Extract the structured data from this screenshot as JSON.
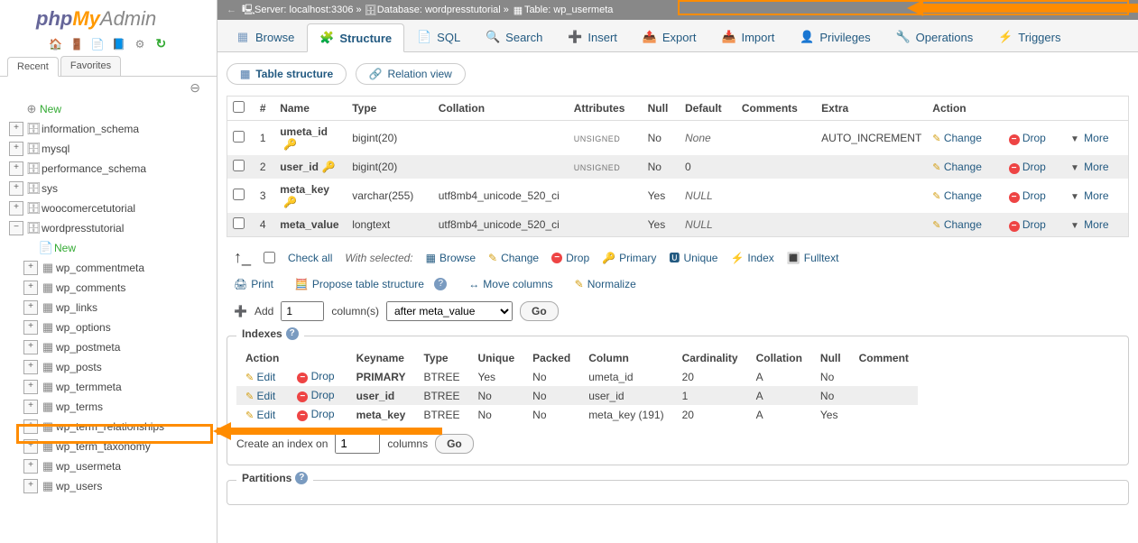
{
  "logo": {
    "php": "php",
    "my": "My",
    "admin": "Admin"
  },
  "sidebar_tabs": {
    "recent": "Recent",
    "favorites": "Favorites"
  },
  "tree": {
    "new": "New",
    "dbs": [
      "information_schema",
      "mysql",
      "performance_schema",
      "sys",
      "woocomercetutorial",
      "wordpresstutorial"
    ],
    "wp_new": "New",
    "tables": [
      "wp_commentmeta",
      "wp_comments",
      "wp_links",
      "wp_options",
      "wp_postmeta",
      "wp_posts",
      "wp_termmeta",
      "wp_terms",
      "wp_term_relationships",
      "wp_term_taxonomy",
      "wp_usermeta",
      "wp_users"
    ]
  },
  "breadcrumb": {
    "server_lbl": "Server:",
    "server_val": "localhost:3306",
    "db_lbl": "Database:",
    "db_val": "wordpresstutorial",
    "table_lbl": "Table:",
    "table_val": "wp_usermeta"
  },
  "top_tabs": {
    "browse": "Browse",
    "structure": "Structure",
    "sql": "SQL",
    "search": "Search",
    "insert": "Insert",
    "export": "Export",
    "import": "Import",
    "privileges": "Privileges",
    "operations": "Operations",
    "triggers": "Triggers"
  },
  "sub_tabs": {
    "table_structure": "Table structure",
    "relation_view": "Relation view"
  },
  "struct_headers": {
    "num": "#",
    "name": "Name",
    "type": "Type",
    "collation": "Collation",
    "attributes": "Attributes",
    "null": "Null",
    "default": "Default",
    "comments": "Comments",
    "extra": "Extra",
    "action": "Action"
  },
  "columns": [
    {
      "num": "1",
      "name": "umeta_id",
      "key": "primary",
      "type": "bigint(20)",
      "collation": "",
      "attributes": "UNSIGNED",
      "null": "No",
      "default": "None",
      "comments": "",
      "extra": "AUTO_INCREMENT"
    },
    {
      "num": "2",
      "name": "user_id",
      "key": "index",
      "type": "bigint(20)",
      "collation": "",
      "attributes": "UNSIGNED",
      "null": "No",
      "default": "0",
      "comments": "",
      "extra": ""
    },
    {
      "num": "3",
      "name": "meta_key",
      "key": "index",
      "type": "varchar(255)",
      "collation": "utf8mb4_unicode_520_ci",
      "attributes": "",
      "null": "Yes",
      "default": "NULL",
      "comments": "",
      "extra": ""
    },
    {
      "num": "4",
      "name": "meta_value",
      "key": "",
      "type": "longtext",
      "collation": "utf8mb4_unicode_520_ci",
      "attributes": "",
      "null": "Yes",
      "default": "NULL",
      "comments": "",
      "extra": ""
    }
  ],
  "row_actions": {
    "change": "Change",
    "drop": "Drop",
    "more": "More"
  },
  "checkall": {
    "check_all": "Check all",
    "with_selected": "With selected:",
    "browse": "Browse",
    "change": "Change",
    "drop": "Drop",
    "primary": "Primary",
    "unique": "Unique",
    "index": "Index",
    "fulltext": "Fulltext"
  },
  "util": {
    "print": "Print",
    "propose": "Propose table structure",
    "move": "Move columns",
    "normalize": "Normalize"
  },
  "add": {
    "label": "Add",
    "cols_label": "column(s)",
    "after_option": "after meta_value",
    "go": "Go",
    "count": "1"
  },
  "indexes": {
    "legend": "Indexes",
    "headers": {
      "action": "Action",
      "keyname": "Keyname",
      "type": "Type",
      "unique": "Unique",
      "packed": "Packed",
      "column": "Column",
      "cardinality": "Cardinality",
      "collation": "Collation",
      "null": "Null",
      "comment": "Comment"
    },
    "rows": [
      {
        "keyname": "PRIMARY",
        "type": "BTREE",
        "unique": "Yes",
        "packed": "No",
        "column": "umeta_id",
        "cardinality": "20",
        "collation": "A",
        "null": "No",
        "comment": ""
      },
      {
        "keyname": "user_id",
        "type": "BTREE",
        "unique": "No",
        "packed": "No",
        "column": "user_id",
        "cardinality": "1",
        "collation": "A",
        "null": "No",
        "comment": ""
      },
      {
        "keyname": "meta_key",
        "type": "BTREE",
        "unique": "No",
        "packed": "No",
        "column": "meta_key (191)",
        "cardinality": "20",
        "collation": "A",
        "null": "Yes",
        "comment": ""
      }
    ],
    "edit": "Edit",
    "drop": "Drop",
    "create": {
      "prefix": "Create an index on",
      "count": "1",
      "suffix": "columns",
      "go": "Go"
    }
  },
  "partitions": {
    "legend": "Partitions"
  }
}
